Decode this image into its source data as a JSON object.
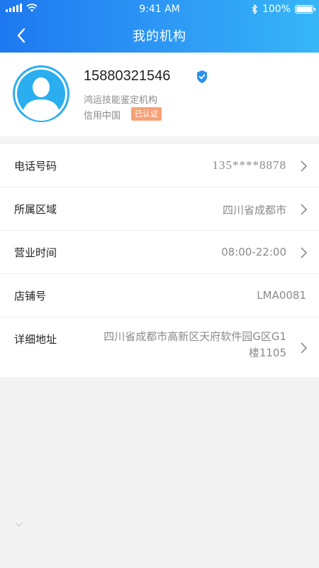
{
  "status_bar": {
    "time": "9:41 AM",
    "battery": "100%"
  },
  "nav": {
    "title": "我的机构",
    "back_icon": "chevron-left-icon"
  },
  "profile": {
    "phone": "15880321546",
    "org_name": "鸿运技能鉴定机构",
    "credit_label": "信用中国",
    "badge": "已认证",
    "badge_color": "#f7a177"
  },
  "rows": [
    {
      "label": "电话号码",
      "value": "135****8878",
      "arrow": true
    },
    {
      "label": "所属区域",
      "value": "四川省成都市",
      "arrow": true
    },
    {
      "label": "营业时间",
      "value": "08:00-22:00",
      "arrow": true
    },
    {
      "label": "店铺号",
      "value": "LMA0081",
      "arrow": false
    },
    {
      "label": "详细地址",
      "value": "四川省成都市高新区天府软件园G区G1楼1105",
      "arrow": true
    }
  ],
  "colors": {
    "header_start": "#1e78f0",
    "header_end": "#36b6f7",
    "avatar": "#2aaef0"
  }
}
